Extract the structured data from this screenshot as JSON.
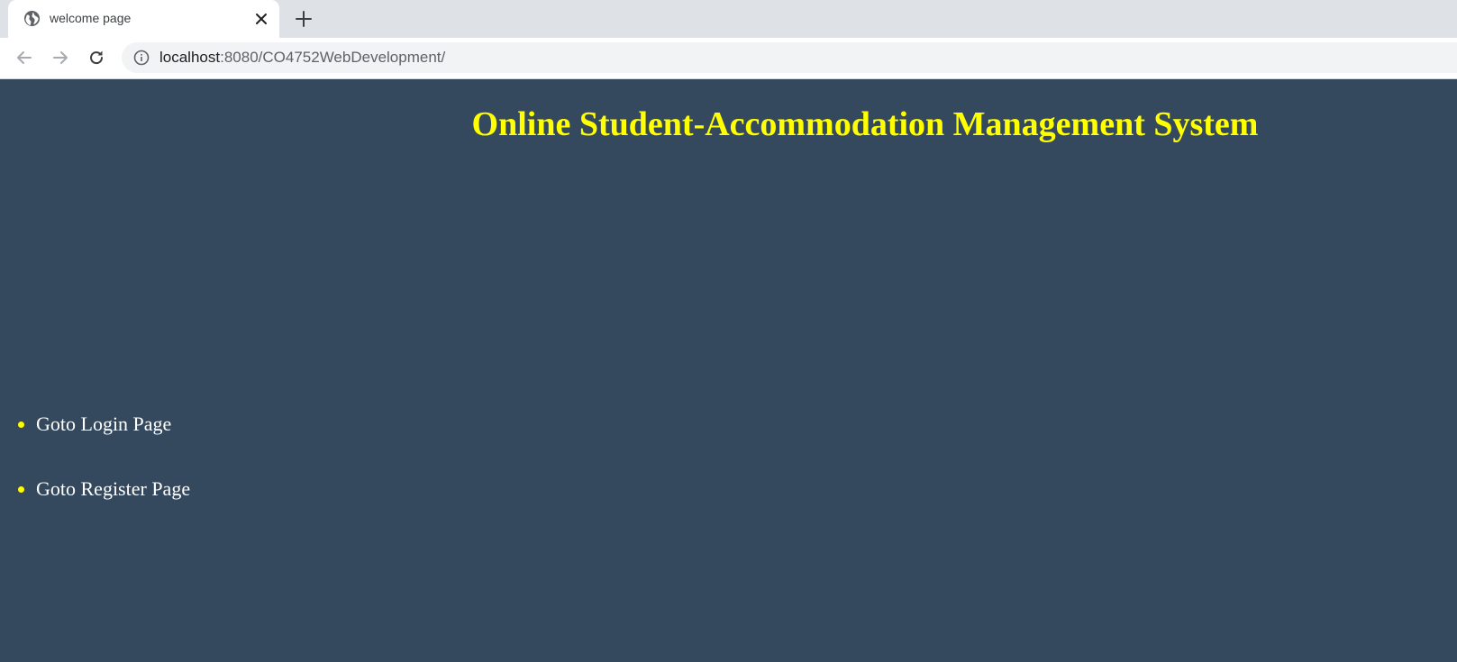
{
  "browser": {
    "tab": {
      "title": "welcome page",
      "favicon": "globe-icon"
    },
    "address_bar": {
      "host": "localhost",
      "path": ":8080/CO4752WebDevelopment/"
    }
  },
  "page": {
    "title": "Online Student-Accommodation Management System",
    "links": [
      {
        "label": "Goto Login Page"
      },
      {
        "label": "Goto Register Page"
      }
    ]
  },
  "colors": {
    "page_background": "#34495e",
    "title": "#ffff00",
    "link_text": "#ffffff",
    "bullet": "#ffff00"
  }
}
